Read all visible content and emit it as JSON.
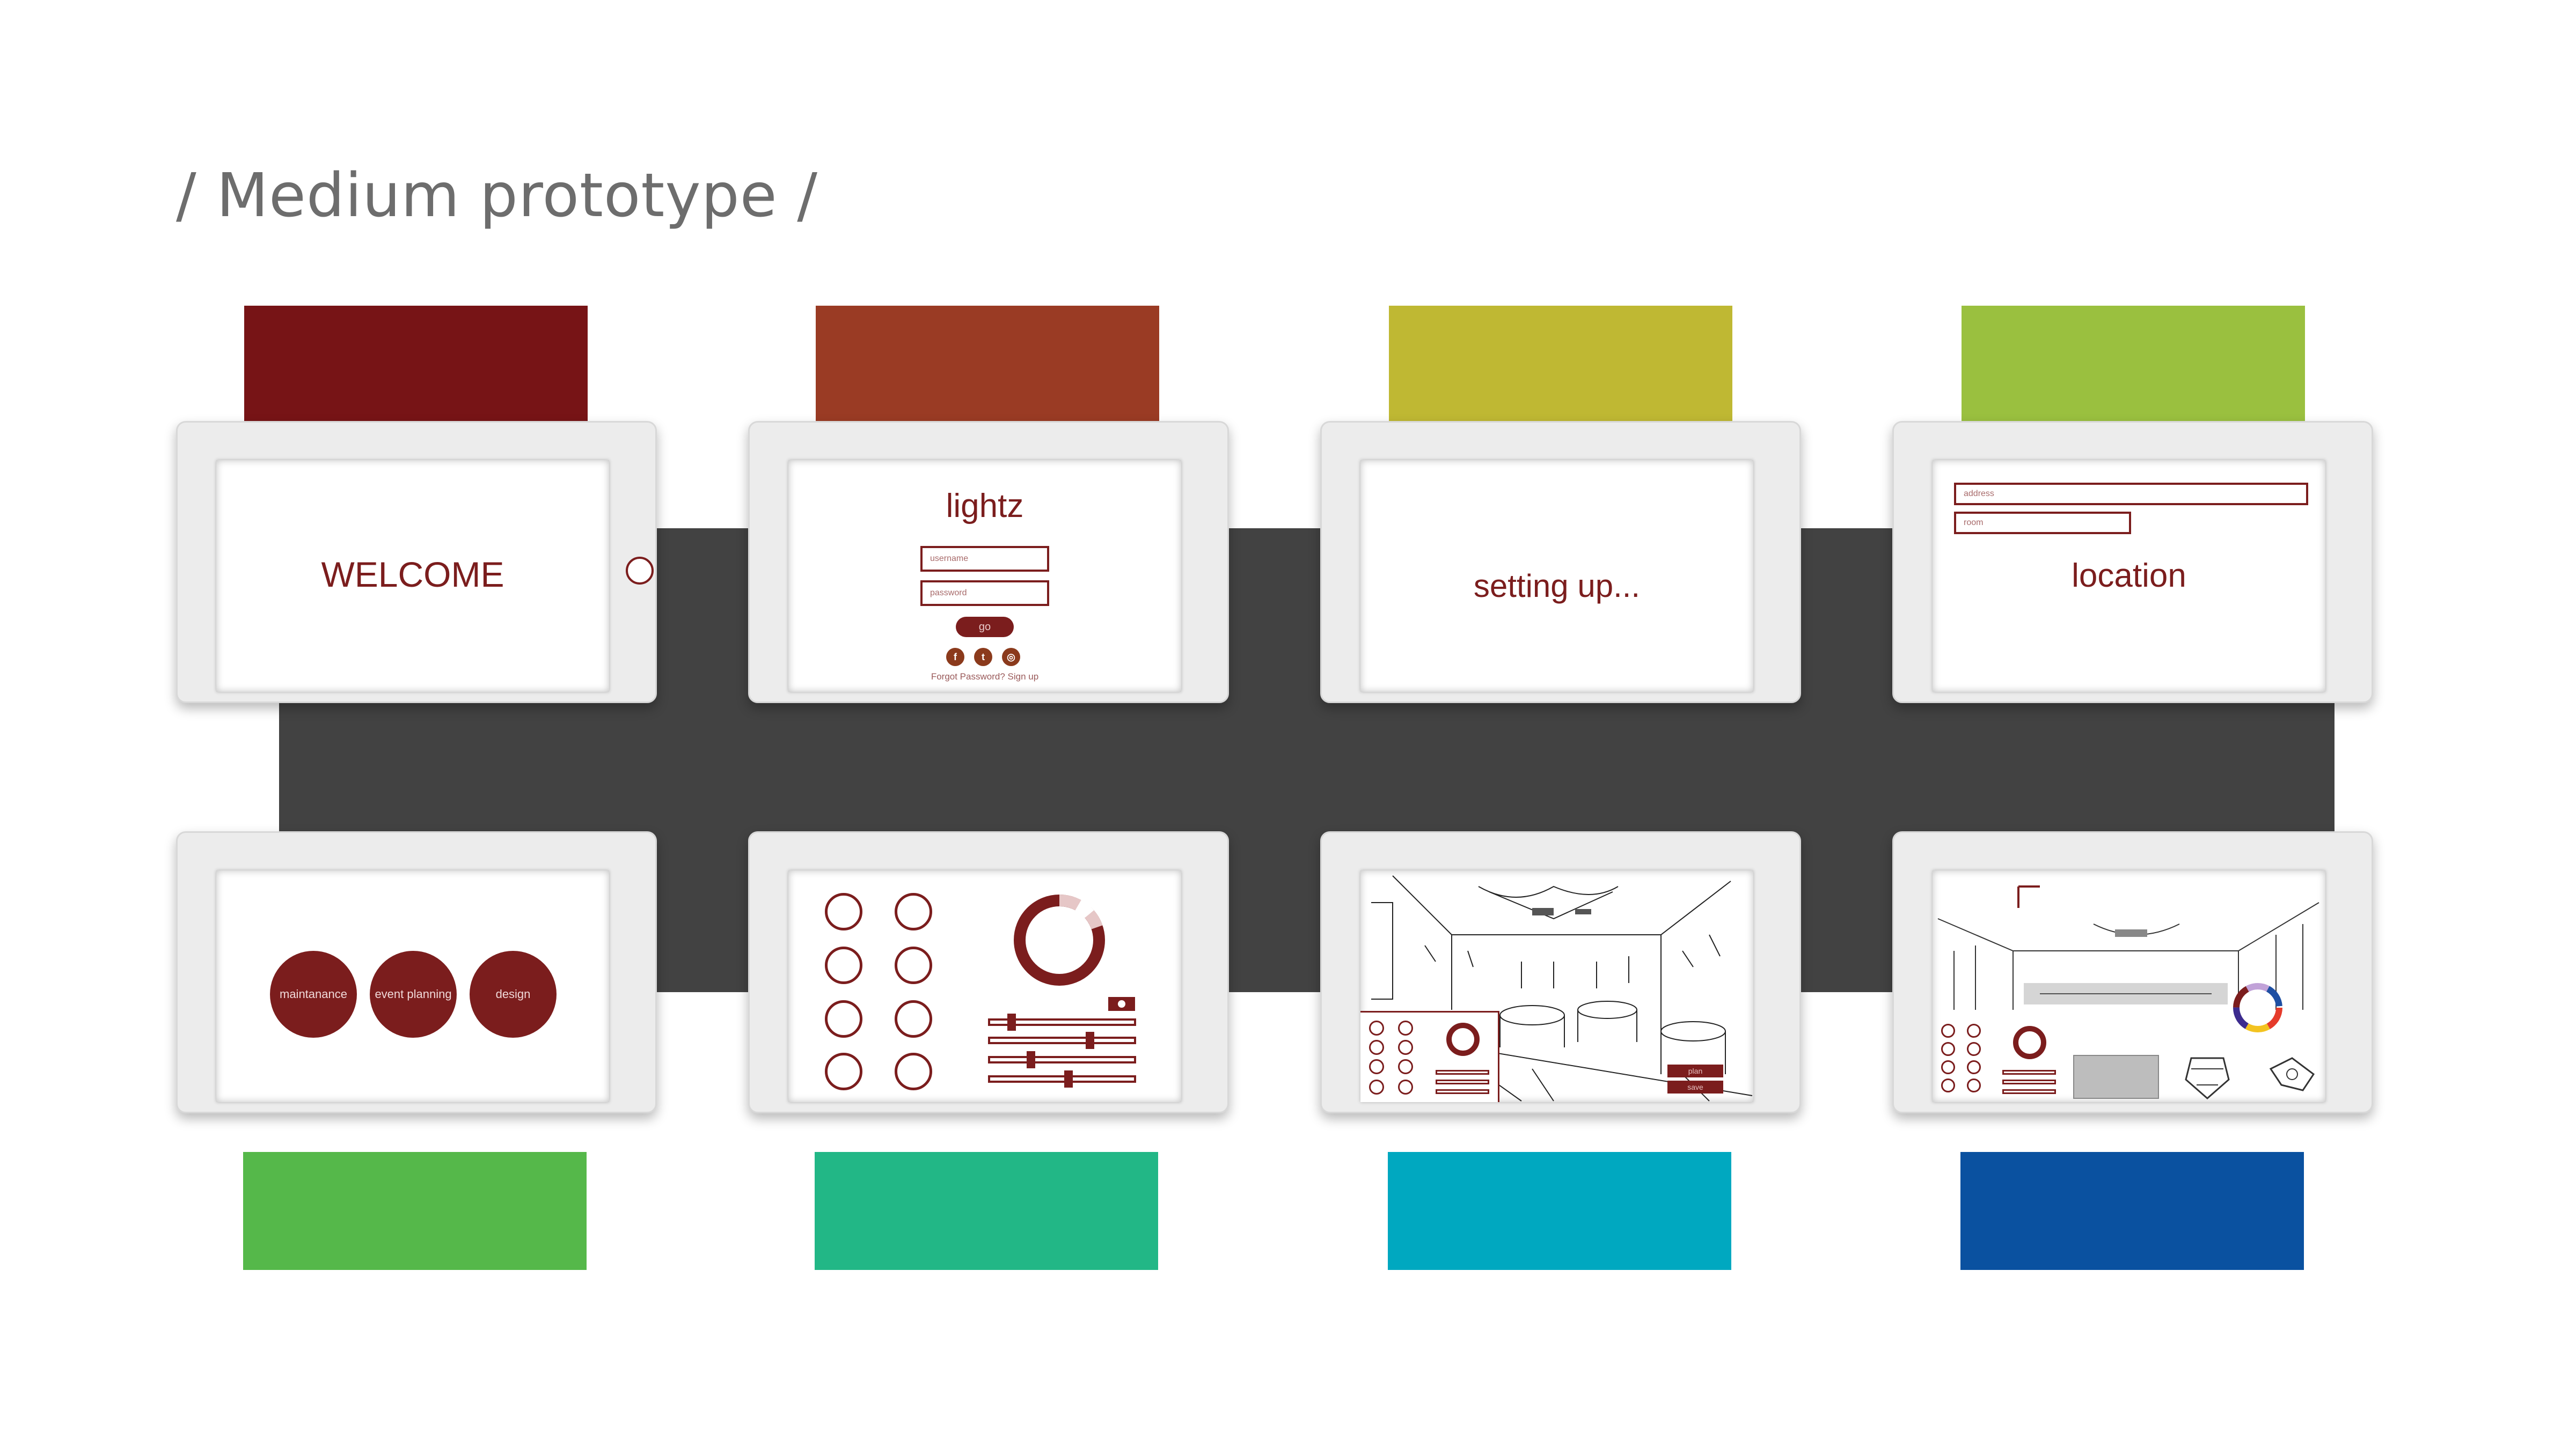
{
  "page": {
    "title": "/ Medium prototype /"
  },
  "palette": {
    "top_tabs": [
      "#771416",
      "#9a3b24",
      "#bfb833",
      "#9ac03f"
    ],
    "bottom_tabs": [
      "#55b84a",
      "#22b786",
      "#00a8c0",
      "#0a51a0"
    ],
    "accent": "#7b1d1d",
    "band": "#424242"
  },
  "screens": {
    "welcome": {
      "heading": "WELCOME"
    },
    "login": {
      "app_name": "lightz",
      "username_placeholder": "username",
      "password_placeholder": "password",
      "go_label": "go",
      "social_icons": [
        "facebook-icon",
        "twitter-icon",
        "instagram-icon"
      ],
      "footer_link": "Forgot Password? Sign up"
    },
    "setup": {
      "status": "setting up..."
    },
    "location": {
      "address_placeholder": "address",
      "room_placeholder": "room",
      "heading": "location"
    },
    "menu": {
      "options": [
        "maintanance",
        "event planning",
        "design"
      ]
    },
    "controls": {
      "toggle_state": "on"
    },
    "planner": {
      "plan_label": "plan",
      "save_label": "save"
    },
    "designer": {}
  }
}
